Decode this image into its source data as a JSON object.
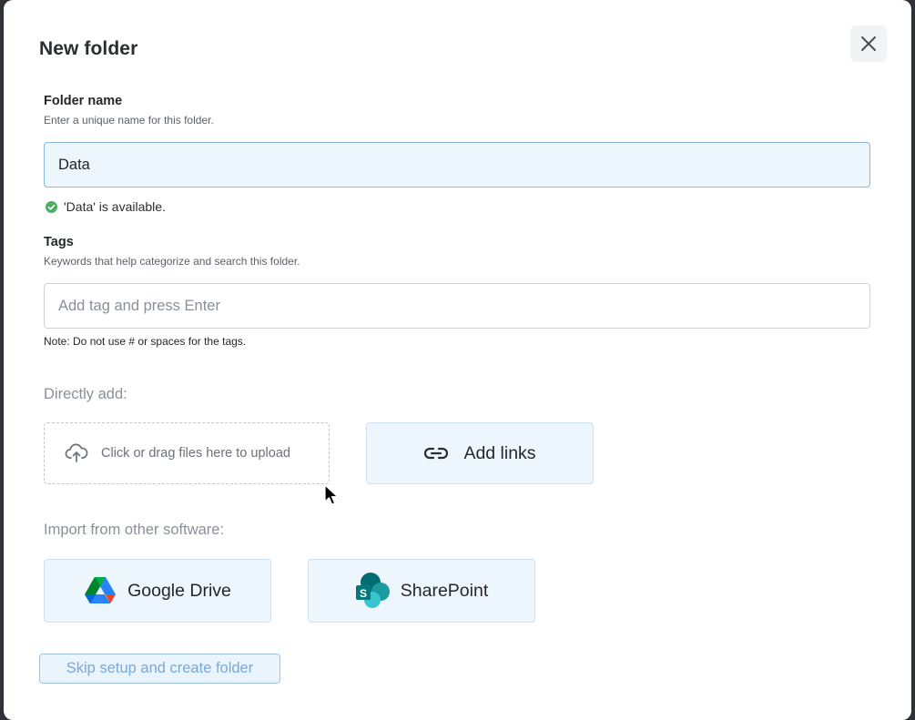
{
  "dialog": {
    "title": "New folder",
    "close_icon": "close-icon"
  },
  "folder_name": {
    "label": "Folder name",
    "help": "Enter a unique name for this folder.",
    "value": "Data",
    "availability": "'Data' is available.",
    "status_color": "#4caf62"
  },
  "tags": {
    "label": "Tags",
    "help": "Keywords that help categorize and search this folder.",
    "placeholder": "Add tag and press Enter",
    "note": "Note: Do not use # or spaces for the tags."
  },
  "direct_add": {
    "label": "Directly add:",
    "upload_text": "Click or drag files here to upload",
    "upload_icon": "cloud-upload-icon",
    "links_label": "Add links",
    "links_icon": "link-icon"
  },
  "import": {
    "label": "Import from other software:",
    "google_drive_label": "Google Drive",
    "sharepoint_label": "SharePoint"
  },
  "footer": {
    "skip_label": "Skip setup and create folder"
  },
  "colors": {
    "accent": "#7aa9d8",
    "tile_bg": "#eef6fd"
  }
}
